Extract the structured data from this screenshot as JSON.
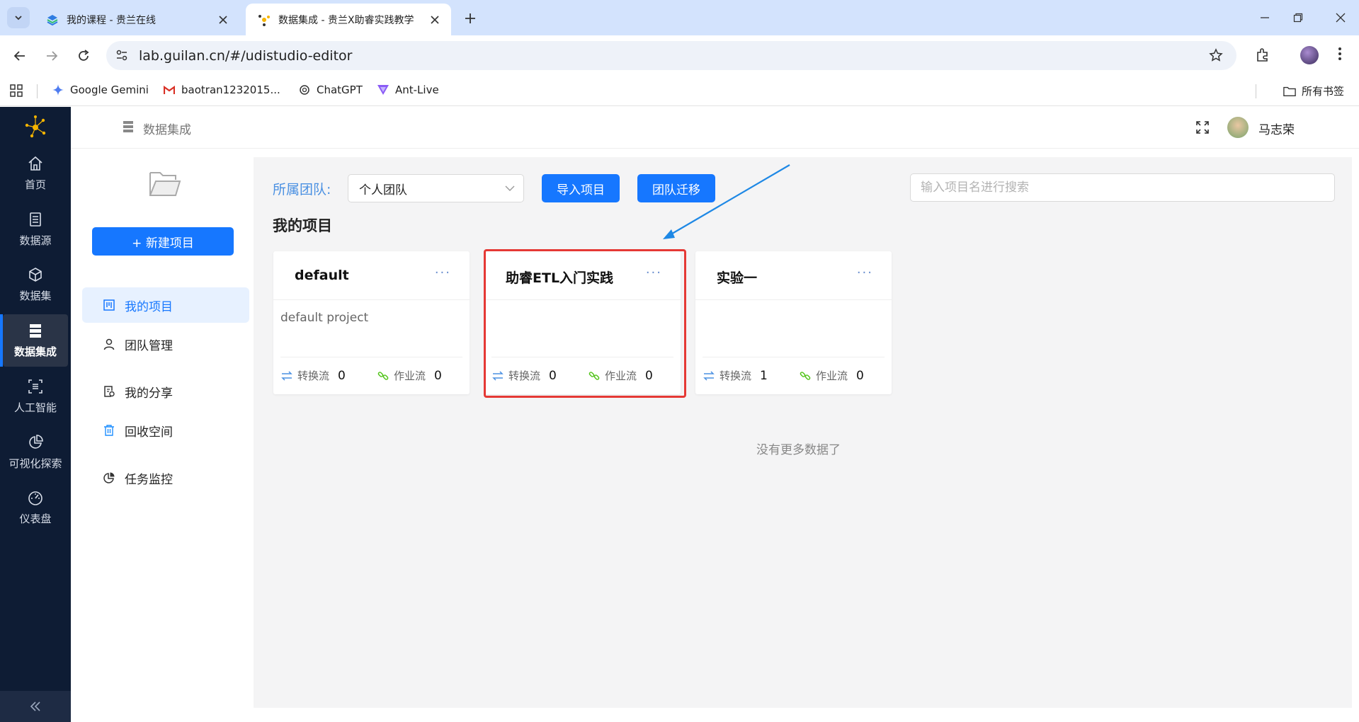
{
  "browser": {
    "tabs": [
      {
        "title": "我的课程 - 贵兰在线",
        "active": false
      },
      {
        "title": "数据集成 - 贵兰X助睿实践教学",
        "active": true
      }
    ],
    "url": "lab.guilan.cn/#/udistudio-editor",
    "bookmarks": [
      {
        "label": "Google Gemini"
      },
      {
        "label": "baotran1232015..."
      },
      {
        "label": "ChatGPT"
      },
      {
        "label": "Ant-Live"
      }
    ],
    "all_bookmarks_label": "所有书签"
  },
  "sidebar": {
    "items": [
      {
        "label": "首页",
        "icon": "home-icon"
      },
      {
        "label": "数据源",
        "icon": "datasource-icon"
      },
      {
        "label": "数据集",
        "icon": "cube-icon"
      },
      {
        "label": "数据集成",
        "icon": "server-icon",
        "active": true
      },
      {
        "label": "人工智能",
        "icon": "ai-icon"
      },
      {
        "label": "可视化探索",
        "icon": "chart-pie-icon"
      },
      {
        "label": "仪表盘",
        "icon": "dashboard-icon"
      }
    ]
  },
  "header": {
    "title": "数据集成",
    "user": "马志荣"
  },
  "left_panel": {
    "new_project": "+ 新建项目",
    "menu": [
      {
        "label": "我的项目",
        "icon": "project-icon",
        "active": true
      },
      {
        "label": "团队管理",
        "icon": "user-icon"
      },
      {
        "label": "我的分享",
        "icon": "share-icon"
      },
      {
        "label": "回收空间",
        "icon": "trash-icon"
      },
      {
        "label": "任务监控",
        "icon": "monitor-icon"
      }
    ]
  },
  "main": {
    "team_label": "所属团队:",
    "team_value": "个人团队",
    "import_button": "导入项目",
    "migrate_button": "团队迁移",
    "search_placeholder": "输入项目名进行搜索",
    "section_title": "我的项目",
    "no_more": "没有更多数据了",
    "projects": [
      {
        "name": "default",
        "desc": "default project",
        "transform_label": "转换流",
        "transform": "0",
        "job_label": "作业流",
        "job": "0"
      },
      {
        "name": "助睿ETL入门实践",
        "desc": "",
        "transform_label": "转换流",
        "transform": "0",
        "job_label": "作业流",
        "job": "0",
        "highlighted": true
      },
      {
        "name": "实验一",
        "desc": "",
        "transform_label": "转换流",
        "transform": "1",
        "job_label": "作业流",
        "job": "0"
      }
    ]
  },
  "colors": {
    "accent": "#1677ff",
    "sidebar_bg": "#0e1c34",
    "highlight": "#e53935",
    "annotation_arrow": "#1e88e5"
  }
}
